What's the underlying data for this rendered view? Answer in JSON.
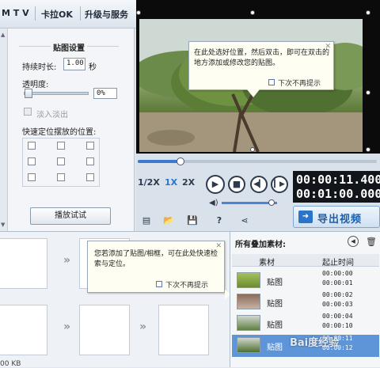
{
  "top_tabs": [
    "M T V",
    "卡拉OK",
    "升级与服务"
  ],
  "settings": {
    "section_title": "贴图设置",
    "duration_label": "持续时长:",
    "duration_value": "1.00",
    "duration_unit": "秒",
    "opacity_label": "透明度:",
    "opacity_value": "0%",
    "opacity_level": 0,
    "fade_label": "淡入淡出",
    "quick_pos_label": "快速定位摆放的位置:",
    "play_test_button": "播放试试"
  },
  "preview": {
    "tip_text": "在此处选好位置，然后双击，即可在双击的地方添加或修改您的贴图。",
    "tip_checkbox": "下次不再提示"
  },
  "controls": {
    "progress_fraction": 0.18,
    "speeds": [
      "1/2X",
      "1X",
      "2X"
    ],
    "current_time": "00:00:11.400",
    "total_time": "00:01:00.000",
    "volume_level": 0.9,
    "export_button": "导出视频"
  },
  "storyboard": {
    "tip_text": "您若添加了贴图/相框，可在此处快速检索与定位。",
    "tip_checkbox": "下次不再提示",
    "size_text": "00 KB"
  },
  "materials": {
    "title": "所有叠加素材:",
    "col_material": "素材",
    "col_time": "起止时间",
    "rows": [
      {
        "name": "贴图",
        "start": "00:00:00",
        "end": "00:00:01",
        "selected": false
      },
      {
        "name": "贴图",
        "start": "00:00:02",
        "end": "00:00:03",
        "selected": false
      },
      {
        "name": "贴图",
        "start": "00:00:04",
        "end": "00:00:10",
        "selected": false
      },
      {
        "name": "贴图",
        "start": "00:00:11",
        "end": "00:00:12",
        "selected": true
      }
    ]
  },
  "watermark": "Bai度经验"
}
